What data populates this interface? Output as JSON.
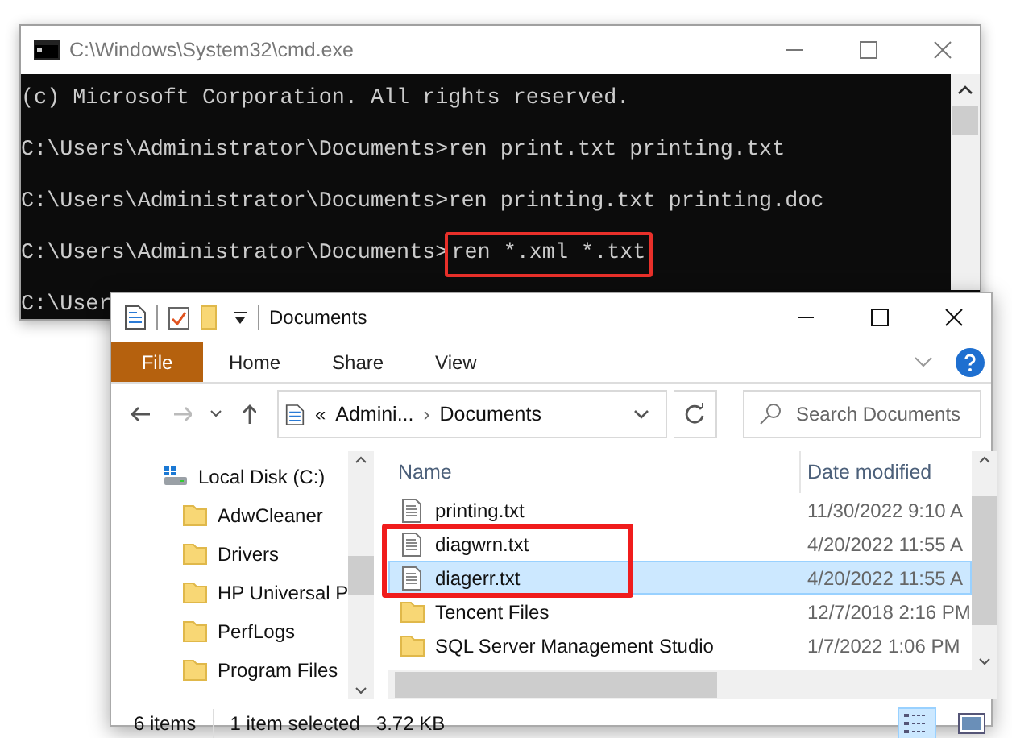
{
  "console_window": {
    "title": "C:\\Windows\\System32\\cmd.exe",
    "lines": [
      {
        "prompt": "(c) Microsoft Corporation. All rights reserved."
      },
      {
        "prompt": "C:\\Users\\Administrator\\Documents>",
        "command": "ren print.txt printing.txt",
        "highlighted": false
      },
      {
        "prompt": "C:\\Users\\Administrator\\Documents>",
        "command": "ren printing.txt printing.doc",
        "highlighted": false
      },
      {
        "prompt": "C:\\Users\\Administrator\\Documents>",
        "command": "ren *.xml *.txt",
        "highlighted": true
      },
      {
        "prompt": "C:\\User"
      }
    ]
  },
  "explorer_window": {
    "title": "Documents",
    "ribbon_tabs": [
      {
        "label": "File",
        "kind": "file"
      },
      {
        "label": "Home",
        "kind": "tab"
      },
      {
        "label": "Share",
        "kind": "tab"
      },
      {
        "label": "View",
        "kind": "tab"
      }
    ],
    "address": {
      "overflow": "«",
      "crumbs": [
        "Admini...",
        "Documents"
      ],
      "separator": "›"
    },
    "search": {
      "placeholder": "Search Documents"
    },
    "nav_pane": [
      {
        "label": "Local Disk (C:)",
        "kind": "drive",
        "children": [
          {
            "label": "AdwCleaner",
            "kind": "folder"
          },
          {
            "label": "Drivers",
            "kind": "folder"
          },
          {
            "label": "HP Universal P",
            "kind": "folder"
          },
          {
            "label": "PerfLogs",
            "kind": "folder"
          },
          {
            "label": "Program Files",
            "kind": "folder"
          }
        ]
      }
    ],
    "columns": [
      "Name",
      "Date modified"
    ],
    "files": [
      {
        "name": "printing.txt",
        "date": "11/30/2022 9:10 A",
        "kind": "file",
        "selected": false,
        "highlighted": false
      },
      {
        "name": "diagwrn.txt",
        "date": "4/20/2022 11:55 A",
        "kind": "file",
        "selected": false,
        "highlighted": true
      },
      {
        "name": "diagerr.txt",
        "date": "4/20/2022 11:55 A",
        "kind": "file",
        "selected": true,
        "highlighted": true
      },
      {
        "name": "Tencent Files",
        "date": "12/7/2018 2:16 PM",
        "kind": "folder",
        "selected": false,
        "highlighted": false
      },
      {
        "name": "SQL Server Management Studio",
        "date": "1/7/2022 1:06 PM",
        "kind": "folder",
        "selected": false,
        "highlighted": false
      }
    ],
    "status_bar": [
      "6 items",
      "1 item selected",
      "3.72 KB"
    ],
    "view_buttons": [
      {
        "kind": "details",
        "selected": true
      },
      {
        "kind": "large_icons",
        "selected": false
      }
    ]
  }
}
